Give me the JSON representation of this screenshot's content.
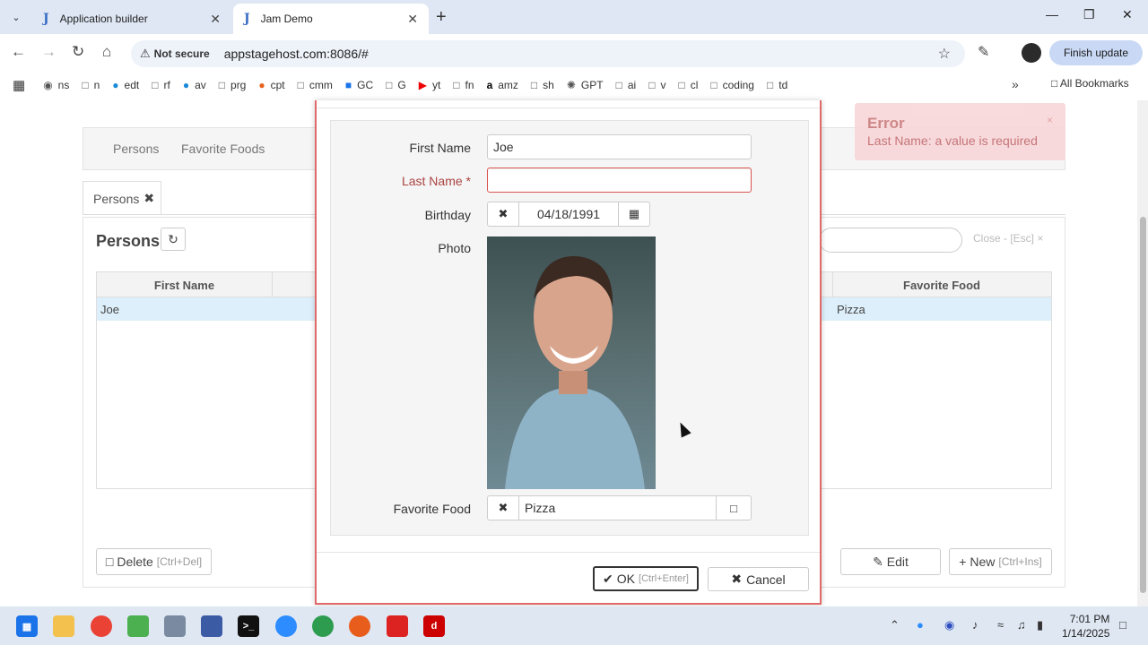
{
  "browser": {
    "tabs": [
      {
        "label": "Application builder",
        "favicon": "J"
      },
      {
        "label": "Jam Demo",
        "favicon": "J"
      }
    ],
    "security_label": "Not secure",
    "url": "appstagehost.com:8086/#",
    "finish_update": "Finish update",
    "bookmarks": [
      "ns",
      "n",
      "edt",
      "rf",
      "av",
      "prg",
      "cpt",
      "cmm",
      "GC",
      "G",
      "yt",
      "fn",
      "amz",
      "sh",
      "GPT",
      "ai",
      "v",
      "cl",
      "coding",
      "td"
    ],
    "all_bookmarks": "All Bookmarks"
  },
  "app": {
    "nav": [
      "Persons",
      "Favorite Foods"
    ],
    "pane_tab": "Persons",
    "panel_title": "Persons",
    "close_hint": "Close - [Esc]",
    "grid": {
      "columns": [
        "First Name",
        "Favorite Food"
      ],
      "rows": [
        {
          "first_name": "Joe",
          "favorite_food": "Pizza"
        }
      ]
    },
    "buttons": {
      "delete": "Delete",
      "delete_hint": "[Ctrl+Del]",
      "edit": "Edit",
      "new": "New",
      "new_hint": "[Ctrl+Ins]"
    }
  },
  "modal": {
    "fields": {
      "first_name_label": "First Name",
      "first_name_value": "Joe",
      "last_name_label": "Last Name",
      "last_name_required": "*",
      "last_name_value": "",
      "birthday_label": "Birthday",
      "birthday_value": "04/18/1991",
      "photo_label": "Photo",
      "favorite_food_label": "Favorite Food",
      "favorite_food_value": "Pizza"
    },
    "ok": "OK",
    "ok_hint": "[Ctrl+Enter]",
    "cancel": "Cancel"
  },
  "toast": {
    "title": "Error",
    "message": "Last Name: a value is required"
  },
  "taskbar": {
    "time": "7:01 PM",
    "date": "1/14/2025"
  },
  "colors": {
    "error_border": "#d9534f",
    "toast_bg": "#f8d7da",
    "selected_row": "#ddeffa"
  }
}
